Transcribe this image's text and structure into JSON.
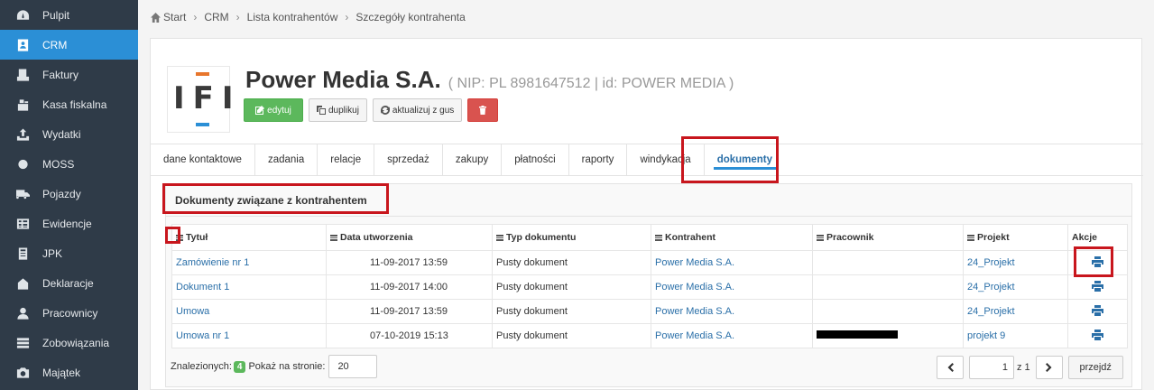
{
  "sidebar": {
    "items": [
      {
        "label": "Pulpit",
        "icon": "dashboard-icon"
      },
      {
        "label": "CRM",
        "icon": "contact-card-icon",
        "active": true
      },
      {
        "label": "Faktury",
        "icon": "invoice-icon"
      },
      {
        "label": "Kasa fiskalna",
        "icon": "cash-register-icon"
      },
      {
        "label": "Wydatki",
        "icon": "upload-icon"
      },
      {
        "label": "MOSS",
        "icon": "circle-icon"
      },
      {
        "label": "Pojazdy",
        "icon": "truck-icon"
      },
      {
        "label": "Ewidencje",
        "icon": "table-icon"
      },
      {
        "label": "JPK",
        "icon": "file-export-icon"
      },
      {
        "label": "Deklaracje",
        "icon": "declaration-icon"
      },
      {
        "label": "Pracownicy",
        "icon": "user-icon"
      },
      {
        "label": "Zobowiązania",
        "icon": "stack-icon"
      },
      {
        "label": "Majątek",
        "icon": "camera-icon"
      }
    ]
  },
  "breadcrumb": [
    "Start",
    "CRM",
    "Lista kontrahentów",
    "Szczegóły kontrahenta"
  ],
  "company": {
    "logo_text": "IFI",
    "name": "Power Media S.A.",
    "meta": "( NIP: PL 8981647512 | id: POWER MEDIA )"
  },
  "buttons": {
    "edit": "edytuj",
    "duplicate": "duplikuj",
    "update_gus": "aktualizuj z gus"
  },
  "tabs": [
    "dane kontaktowe",
    "zadania",
    "relacje",
    "sprzedaż",
    "zakupy",
    "płatności",
    "raporty",
    "windykacja",
    "dokumenty"
  ],
  "active_tab": "dokumenty",
  "panel_title": "Dokumenty związane z kontrahentem",
  "table": {
    "headers": [
      "Tytuł",
      "Data utworzenia",
      "Typ dokumentu",
      "Kontrahent",
      "Pracownik",
      "Projekt",
      "Akcje"
    ],
    "rows": [
      {
        "title": "Zamówienie nr 1",
        "date": "11-09-2017 13:59",
        "type": "Pusty dokument",
        "contractor": "Power Media S.A.",
        "employee": "",
        "project": "24_Projekt"
      },
      {
        "title": "Dokument 1",
        "date": "11-09-2017 14:00",
        "type": "Pusty dokument",
        "contractor": "Power Media S.A.",
        "employee": "",
        "project": "24_Projekt"
      },
      {
        "title": "Umowa",
        "date": "11-09-2017 13:59",
        "type": "Pusty dokument",
        "contractor": "Power Media S.A.",
        "employee": "",
        "project": "24_Projekt"
      },
      {
        "title": "Umowa nr 1",
        "date": "07-10-2019 15:13",
        "type": "Pusty dokument",
        "contractor": "Power Media S.A.",
        "employee": "[redacted]",
        "project": "projekt 9"
      }
    ]
  },
  "pagination": {
    "found_label": "Znalezionych:",
    "found_count": "4",
    "per_page_label": "Pokaż na stronie:",
    "per_page_value": "20",
    "page_value": "1",
    "of_label": "z 1",
    "go_label": "przejdź"
  },
  "colors": {
    "sidebar_bg": "#2f3b48",
    "accent": "#2b8fd6",
    "link": "#2a6fa8",
    "highlight_box": "#c8161d",
    "success": "#5cb85c",
    "danger": "#d9534f"
  }
}
